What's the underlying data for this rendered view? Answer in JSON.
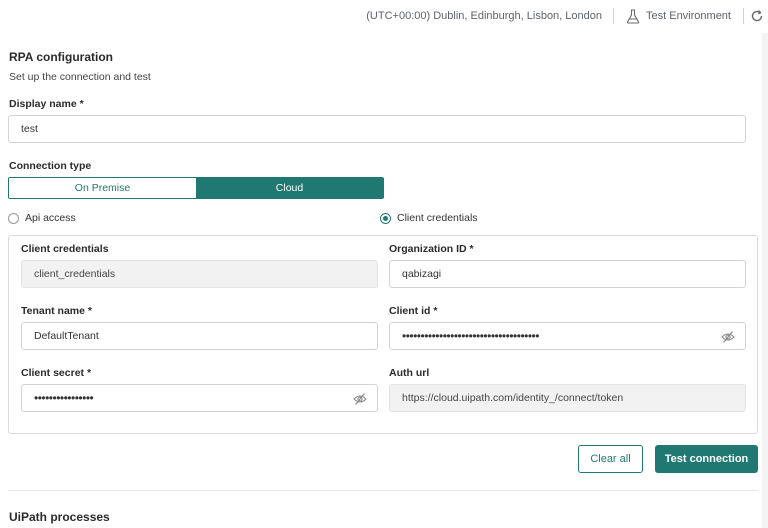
{
  "header": {
    "timezone": "(UTC+00:00) Dublin, Edinburgh, Lisbon, London",
    "environment": "Test Environment"
  },
  "rpa": {
    "title": "RPA configuration",
    "subtitle": "Set up the connection and test",
    "display_name_label": "Display name *",
    "display_name_value": "test",
    "connection_type_label": "Connection type",
    "connection_types": [
      "On Premise",
      "Cloud"
    ],
    "connection_type_selected": "Cloud",
    "auth_options": [
      "Api access",
      "Client credentials"
    ],
    "auth_selected": "Client credentials"
  },
  "credentials": {
    "client_credentials_label": "Client credentials",
    "client_credentials_value": "client_credentials",
    "organization_id_label": "Organization ID *",
    "organization_id_value": "qabizagi",
    "tenant_name_label": "Tenant name *",
    "tenant_name_value": "DefaultTenant",
    "client_id_label": "Client id *",
    "client_id_value": "•••••••••••••••••••••••••••••••••••••",
    "client_secret_label": "Client secret *",
    "client_secret_value": "••••••••••••••••",
    "auth_url_label": "Auth url",
    "auth_url_value": "https://cloud.uipath.com/identity_/connect/token"
  },
  "actions": {
    "clear_label": "Clear all",
    "test_label": "Test connection"
  },
  "processes": {
    "title": "UiPath processes"
  },
  "colors": {
    "accent": "#1f7872",
    "border": "#d3d3d3",
    "readonly_bg": "#f2f2f2"
  },
  "icons": {
    "environment": "flask-icon",
    "refresh": "refresh-icon",
    "password_toggle": "eye-off-icon"
  }
}
